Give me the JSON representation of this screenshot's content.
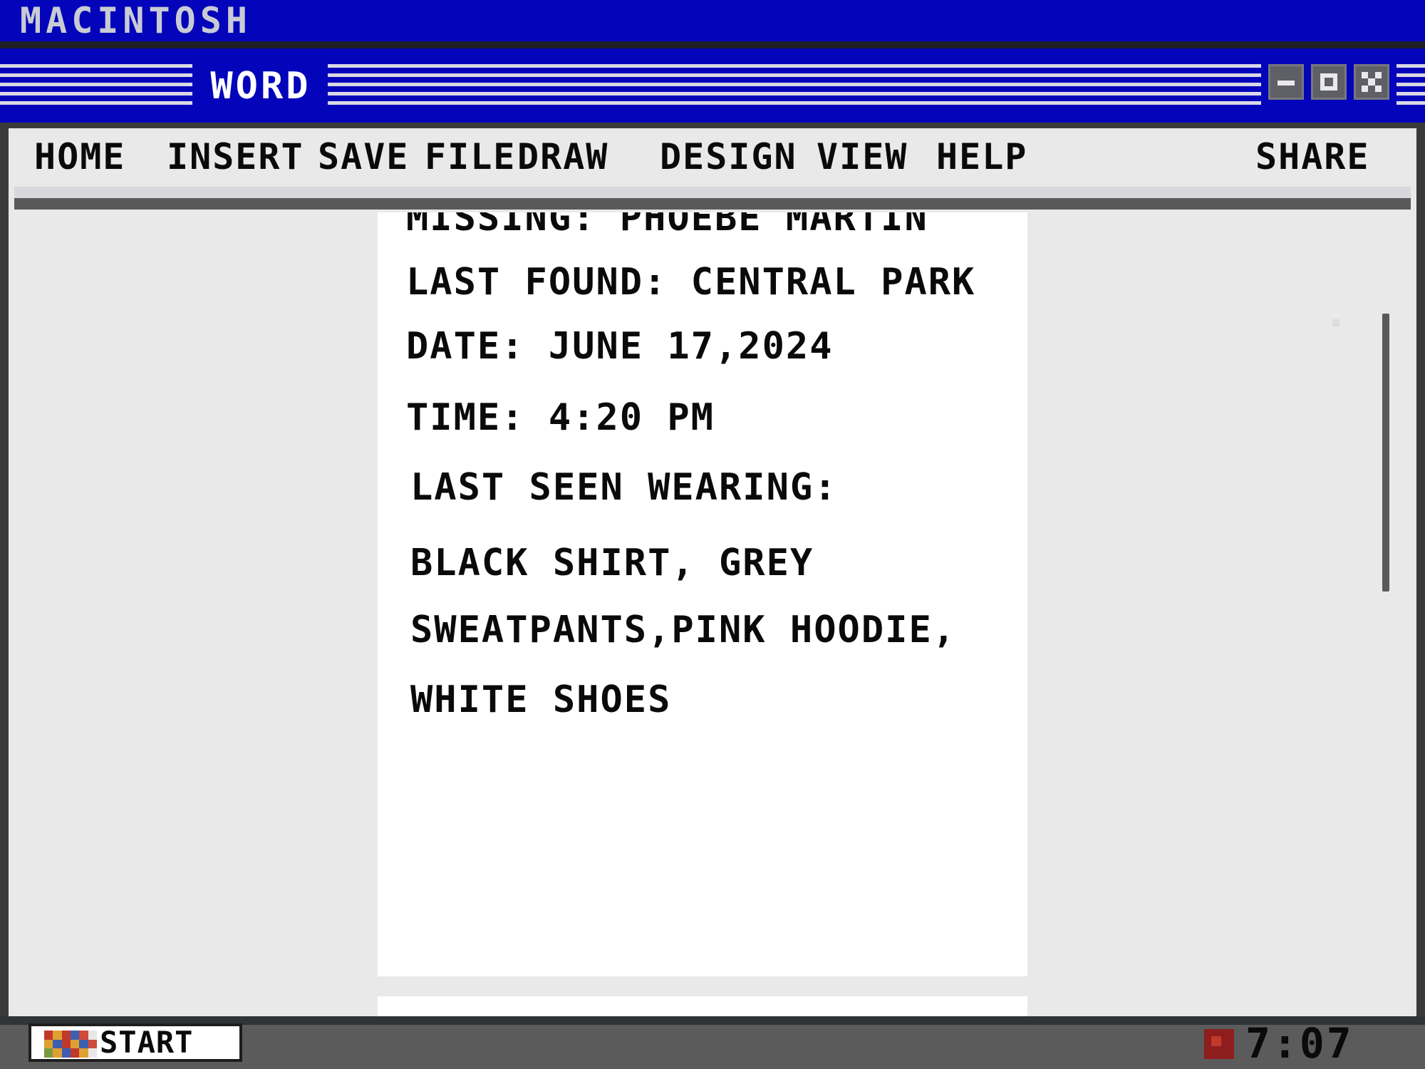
{
  "os_bar": {
    "title": "MACINTOSH"
  },
  "window": {
    "title": "WORD",
    "controls": {
      "minimize": "minimize-icon",
      "maximize": "maximize-icon",
      "close": "close-icon"
    }
  },
  "menu": {
    "home": "HOME",
    "insert": "INSERT",
    "save": "SAVE",
    "file": "FILE",
    "draw": "DRAW",
    "design": "DESIGN",
    "view": "VIEW",
    "help": "HELP",
    "share": "SHARE"
  },
  "document": {
    "line_missing": "MISSING: PHOEBE MARTIN",
    "line_last_found": "LAST FOUND:  CENTRAL PARK",
    "line_date": "DATE: JUNE 17,2024",
    "line_time": "TIME:  4:20 PM",
    "line_last_seen": "LAST SEEN WEARING:",
    "line_clothes_1": "Black  shirt, Grey",
    "line_clothes_2": "SWEATPANTS,PINK HOODIE,",
    "line_clothes_3": "WHITE  SHOES"
  },
  "taskbar": {
    "start_label": "START",
    "clock": "7:07 PM",
    "colors": {
      "taskbar": "#5b5b5b",
      "title_blue": "#0404ba"
    }
  }
}
